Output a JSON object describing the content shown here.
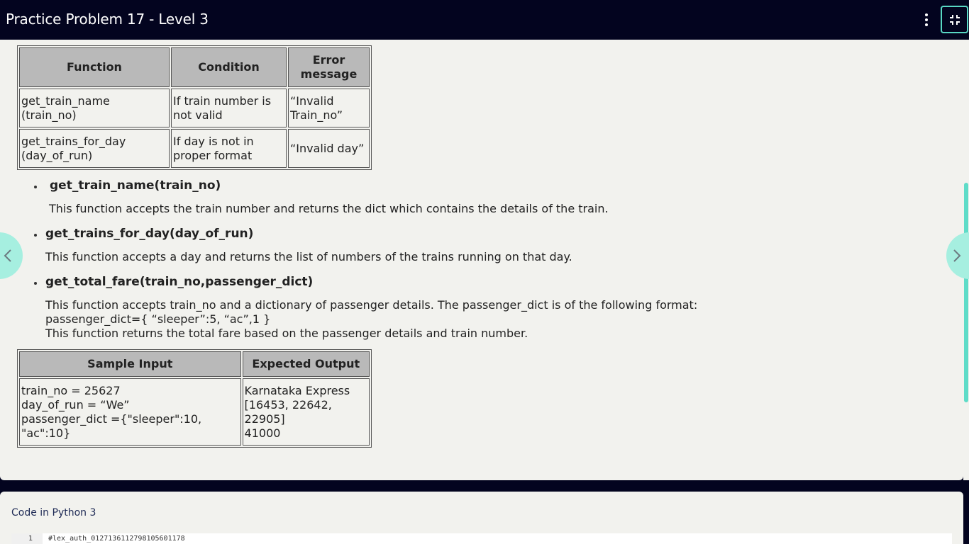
{
  "header": {
    "title": "Practice Problem 17 - Level 3"
  },
  "error_table": {
    "headers": [
      "Function",
      "Condition",
      "Error message"
    ],
    "rows": [
      [
        "get_train_name (train_no)",
        "If train number is not valid",
        "“Invalid Train_no”"
      ],
      [
        "get_trains_for_day (day_of_run)",
        "If day is not in proper format",
        "“Invalid day”"
      ]
    ]
  },
  "functions": [
    {
      "name": "get_train_name(train_no)",
      "description": "This function accepts the train number and returns the dict which contains the details of the train."
    },
    {
      "name": "get_trains_for_day(day_of_run)",
      "description": "This function accepts a day and returns the list of numbers of the trains running on that day."
    },
    {
      "name": "get_total_fare(train_no,passenger_dict)",
      "description_lines": [
        "This function accepts train_no and a dictionary of passenger details. The passenger_dict is of the following format:",
        "passenger_dict={ “sleeper”:5, “ac”,1 }",
        "This function returns the total fare based on the passenger details and train number."
      ]
    }
  ],
  "sample_table": {
    "headers": [
      "Sample Input",
      "Expected Output"
    ],
    "input_lines": [
      "train_no = 25627",
      "day_of_run = “We”",
      "passenger_dict ={\"sleeper\":10,",
      "\"ac\":10}"
    ],
    "output_lines": [
      "Karnataka Express",
      "[16453, 22642,",
      "22905]",
      "41000"
    ]
  },
  "editor": {
    "language_label": "Code in Python 3",
    "line_number": "1",
    "code_line": "#lex_auth_01271361127981056011​78"
  },
  "icons": {
    "menu": "kebab-menu-icon",
    "collapse": "collapse-fullscreen-icon",
    "prev": "chevron-left-icon",
    "next": "chevron-right-icon"
  },
  "colors": {
    "header_bg": "#03041f",
    "panel_bg": "#f2f2ee",
    "accent": "#59d8c4",
    "nav_button": "#a6efe0",
    "table_header_bg": "#b9b9b9"
  }
}
